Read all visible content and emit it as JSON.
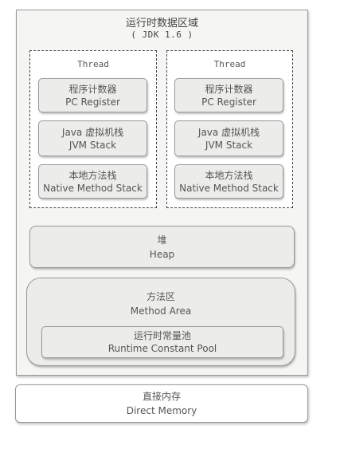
{
  "runtime_area": {
    "title": "运行时数据区域",
    "subtitle": "( JDK 1.6 )"
  },
  "threads": [
    {
      "label": "Thread",
      "boxes": [
        {
          "zh": "程序计数器",
          "en": "PC Register"
        },
        {
          "zh": "Java 虚拟机栈",
          "en": "JVM Stack"
        },
        {
          "zh": "本地方法栈",
          "en": "Native Method Stack"
        }
      ]
    },
    {
      "label": "Thread",
      "boxes": [
        {
          "zh": "程序计数器",
          "en": "PC Register"
        },
        {
          "zh": "Java 虚拟机栈",
          "en": "JVM Stack"
        },
        {
          "zh": "本地方法栈",
          "en": "Native Method Stack"
        }
      ]
    }
  ],
  "heap": {
    "zh": "堆",
    "en": "Heap"
  },
  "method_area": {
    "zh": "方法区",
    "en": "Method Area",
    "constant_pool": {
      "zh": "运行时常量池",
      "en": "Runtime Constant Pool"
    }
  },
  "direct_memory": {
    "zh": "直接内存",
    "en": "Direct Memory"
  }
}
